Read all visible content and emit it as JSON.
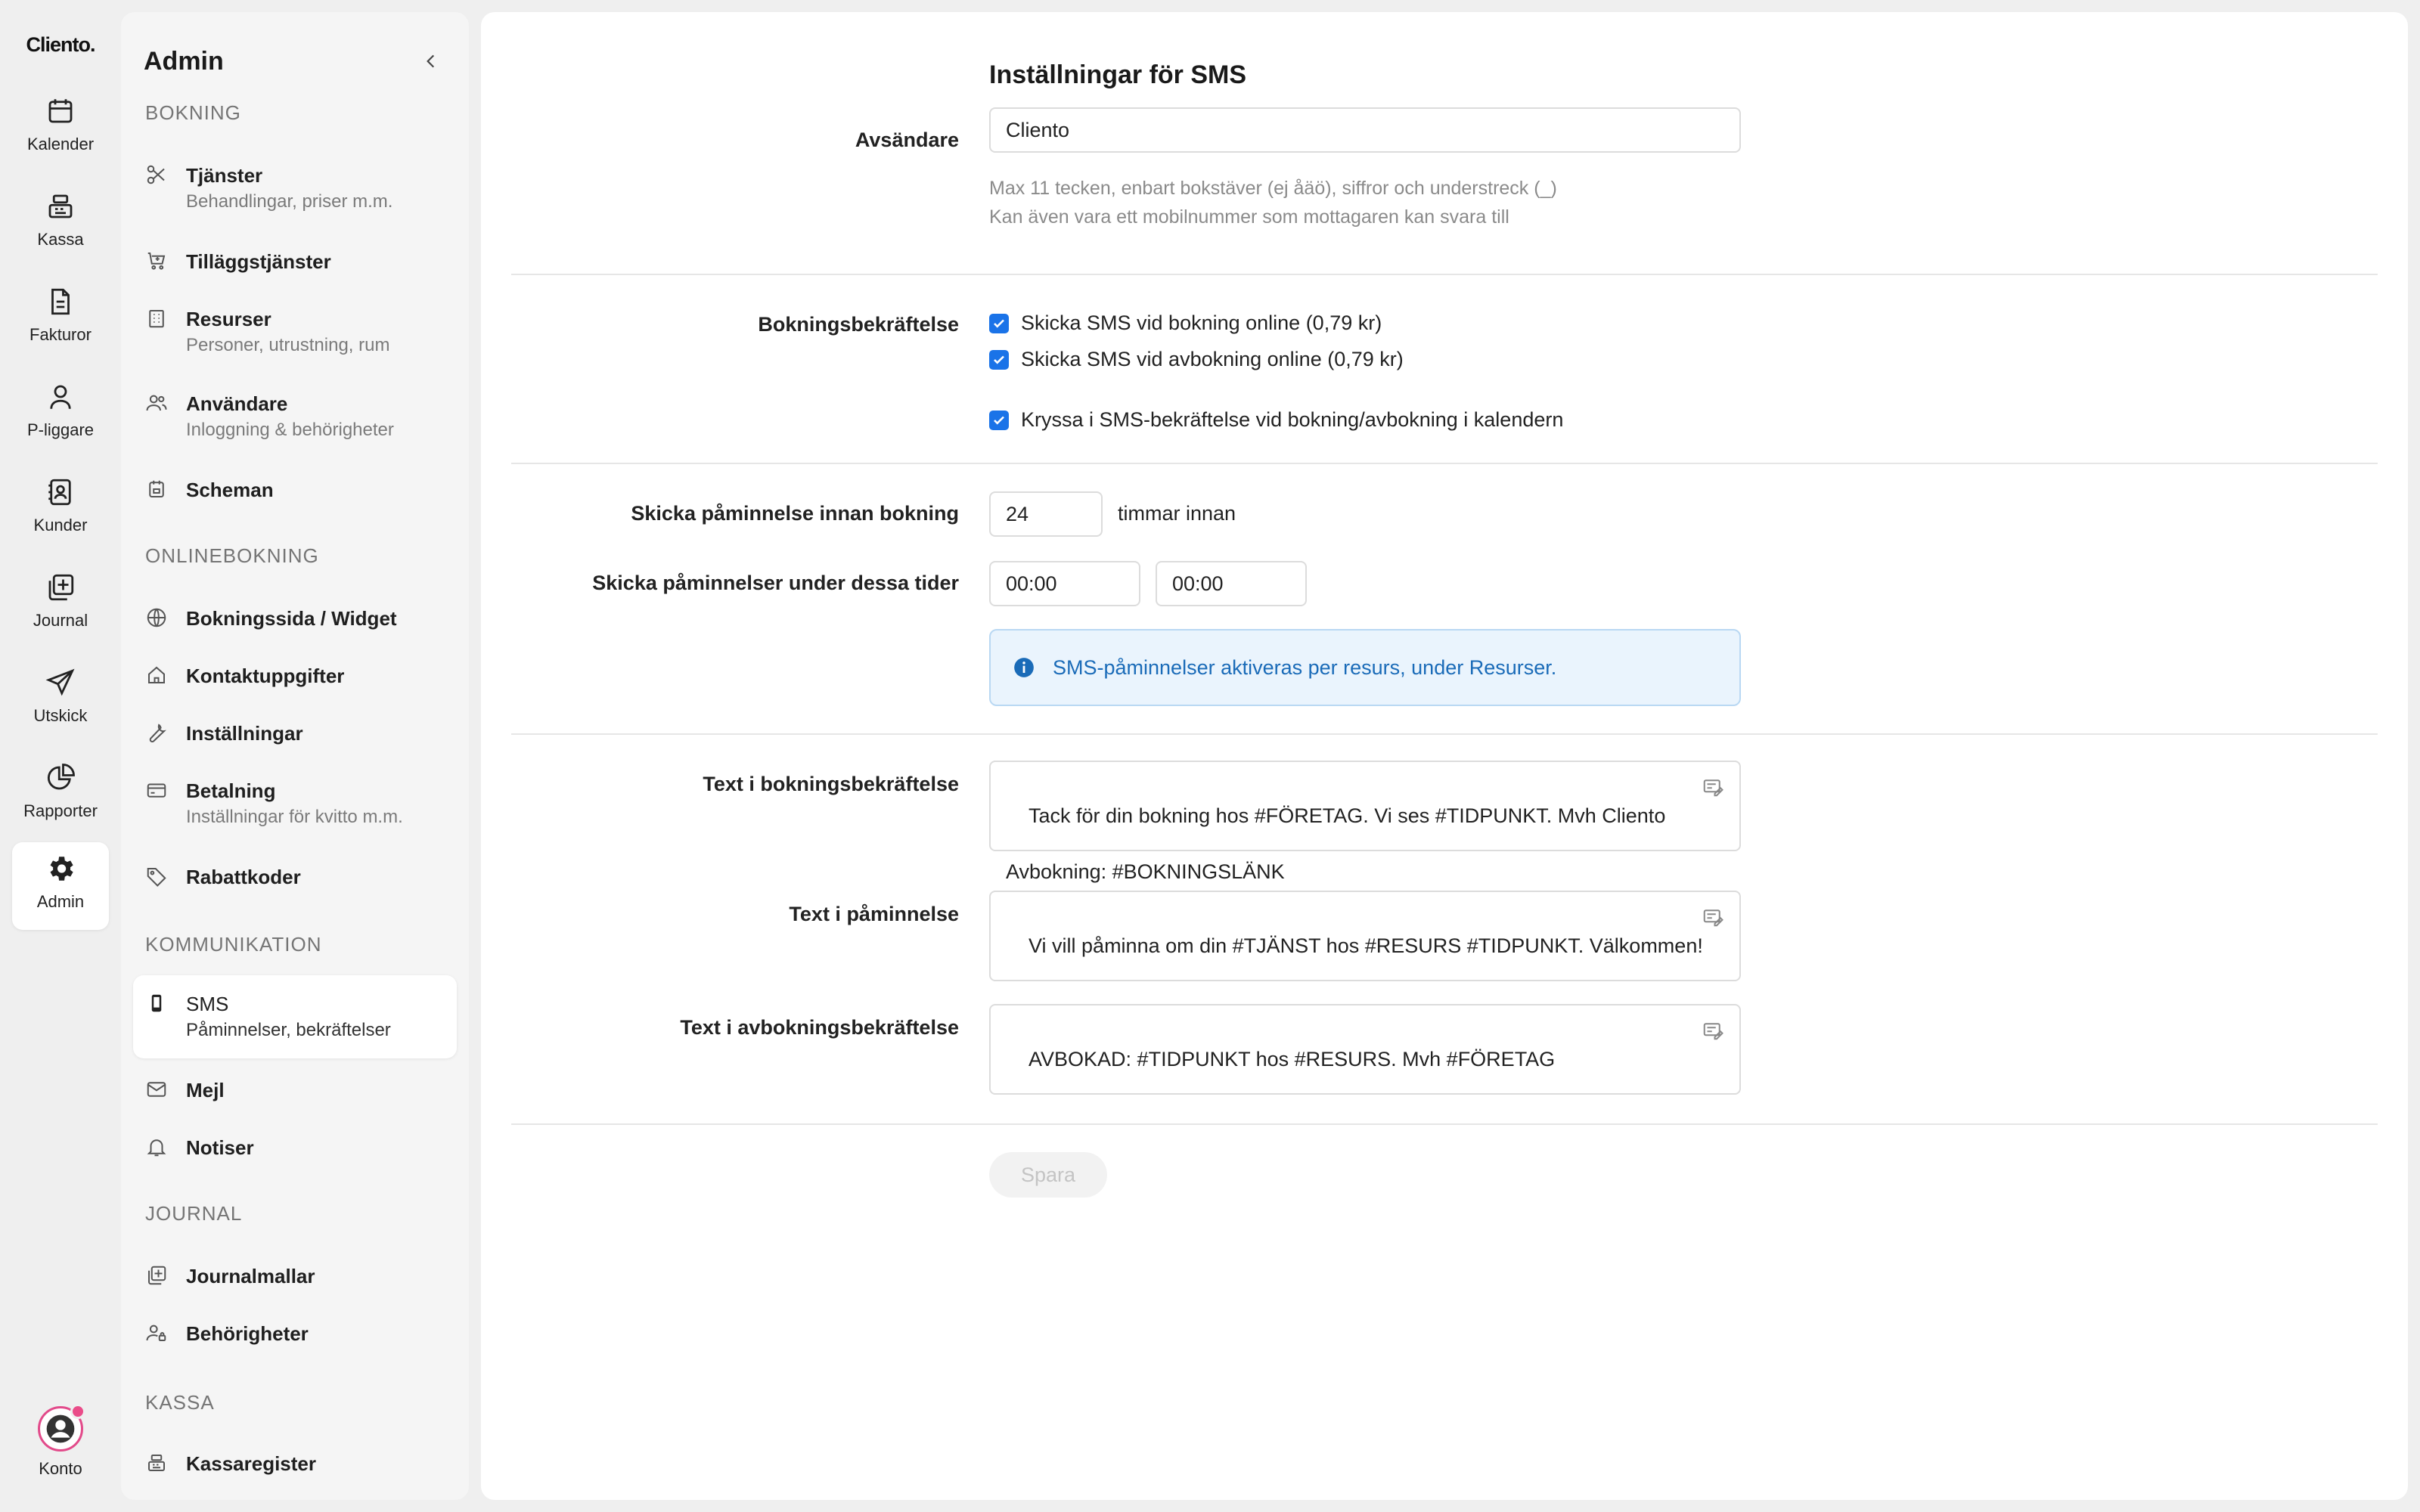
{
  "rail": {
    "logo": "Cliento.",
    "items": [
      {
        "label": "Kalender",
        "icon": "calendar-icon"
      },
      {
        "label": "Kassa",
        "icon": "cash-register-icon"
      },
      {
        "label": "Fakturor",
        "icon": "invoice-icon"
      },
      {
        "label": "P-liggare",
        "icon": "person-icon"
      },
      {
        "label": "Kunder",
        "icon": "contacts-icon"
      },
      {
        "label": "Journal",
        "icon": "journal-icon"
      },
      {
        "label": "Utskick",
        "icon": "send-icon"
      },
      {
        "label": "Rapporter",
        "icon": "pie-chart-icon"
      },
      {
        "label": "Admin",
        "icon": "gear-icon",
        "active": true
      }
    ],
    "account_label": "Konto"
  },
  "sidebar": {
    "title": "Admin",
    "sections": {
      "bokning": "BOKNING",
      "onlinebokning": "ONLINEBOKNING",
      "kommunikation": "KOMMUNIKATION",
      "journal": "JOURNAL",
      "kassa": "KASSA"
    },
    "items": {
      "tjanster": {
        "label": "Tjänster",
        "sub": "Behandlingar, priser m.m."
      },
      "tillagg": {
        "label": "Tilläggstjänster"
      },
      "resurser": {
        "label": "Resurser",
        "sub": "Personer, utrustning, rum"
      },
      "anvandare": {
        "label": "Användare",
        "sub": "Inloggning & behörigheter"
      },
      "scheman": {
        "label": "Scheman"
      },
      "bokningssida": {
        "label": "Bokningssida / Widget"
      },
      "kontakt": {
        "label": "Kontaktuppgifter"
      },
      "installningar": {
        "label": "Inställningar"
      },
      "betalning": {
        "label": "Betalning",
        "sub": "Inställningar för kvitto m.m."
      },
      "rabatt": {
        "label": "Rabattkoder"
      },
      "sms": {
        "label": "SMS",
        "sub": "Påminnelser, bekräftelser"
      },
      "mejl": {
        "label": "Mejl"
      },
      "notiser": {
        "label": "Notiser"
      },
      "journalmallar": {
        "label": "Journalmallar"
      },
      "behorigheter": {
        "label": "Behörigheter"
      },
      "kassaregister": {
        "label": "Kassaregister"
      }
    }
  },
  "form": {
    "title": "Inställningar för SMS",
    "sender": {
      "label": "Avsändare",
      "value": "Cliento",
      "hint1": "Max 11 tecken, enbart bokstäver (ej åäö), siffror och understreck (_)",
      "hint2": "Kan även vara ett mobilnummer som mottagaren kan svara till"
    },
    "confirmation": {
      "label": "Bokningsbekräftelse",
      "check1": "Skicka SMS vid bokning online (0,79 kr)",
      "check2": "Skicka SMS vid avbokning online (0,79 kr)",
      "check3": "Kryssa i SMS-bekräftelse vid bokning/avbokning i kalendern"
    },
    "reminder": {
      "label": "Skicka påminnelse innan bokning",
      "hours": "24",
      "suffix": "timmar innan",
      "window_label": "Skicka påminnelser under dessa tider",
      "from": "00:00",
      "to": "00:00"
    },
    "info": {
      "text": "SMS-påminnelser aktiveras per resurs, under ",
      "link": "Resurser",
      "tail": "."
    },
    "texts": {
      "booking_label": "Text i bokningsbekräftelse",
      "booking_value": "Tack för din bokning hos #FÖRETAG. Vi ses #TIDPUNKT. Mvh Cliento\n\nAvbokning: #BOKNINGSLÄNK",
      "reminder_label": "Text i påminnelse",
      "reminder_value": "Vi vill påminna om din #TJÄNST hos #RESURS #TIDPUNKT. Välkommen!",
      "cancel_label": "Text i avbokningsbekräftelse",
      "cancel_value": "AVBOKAD: #TIDPUNKT hos #RESURS. Mvh #FÖRETAG"
    },
    "save_label": "Spara"
  },
  "colors": {
    "accent": "#1a73e8",
    "info_bg": "#eaf4fd",
    "info_text": "#1a6bb8",
    "notification_dot": "#ea4c89"
  }
}
